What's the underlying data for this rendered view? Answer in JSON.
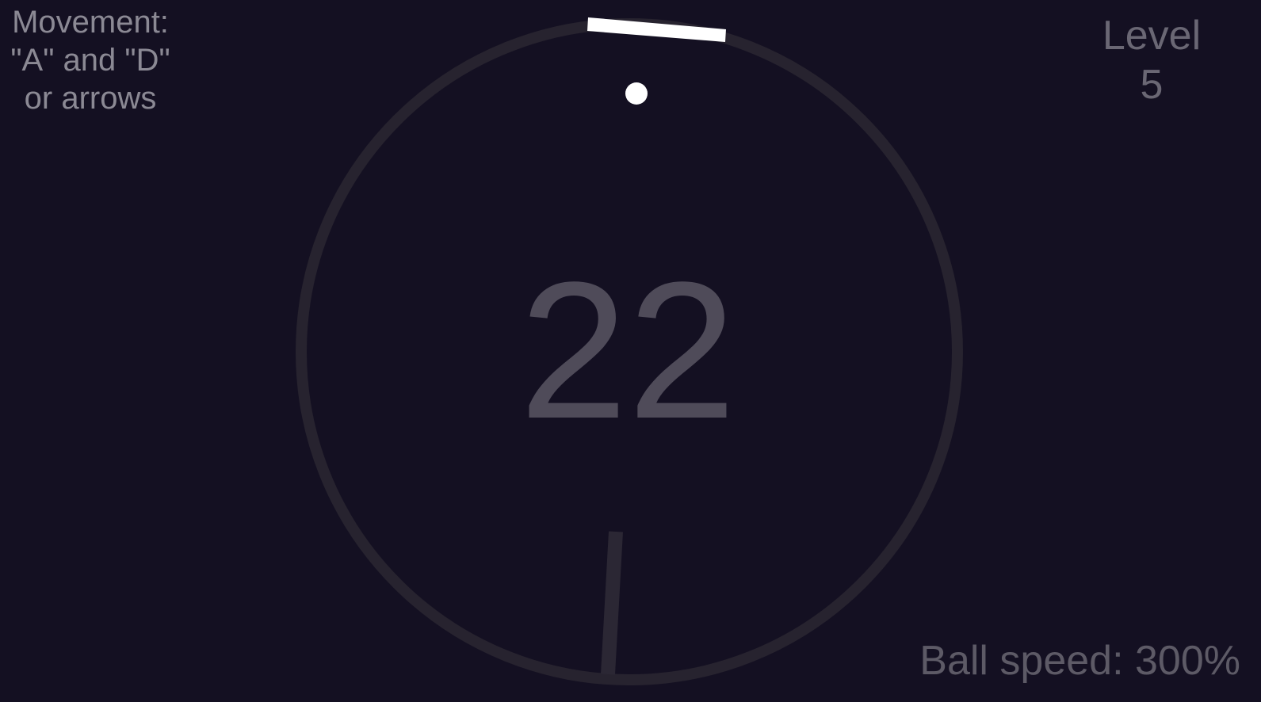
{
  "hud": {
    "controls_hint": "Movement:\n\"A\" and \"D\"\nor arrows",
    "level_label": "Level",
    "level_value": "5",
    "ball_speed": "Ball speed: 300%"
  },
  "game": {
    "score": "22",
    "colors": {
      "background": "#141022",
      "arena_ring": "#27232f",
      "paddle": "#ffffff",
      "ball": "#ffffff",
      "score_text": "#4f4b59",
      "spoke": "#2b2734"
    },
    "icons": [
      "arena-ring",
      "player-paddle",
      "ball",
      "obstacle-spoke"
    ]
  }
}
